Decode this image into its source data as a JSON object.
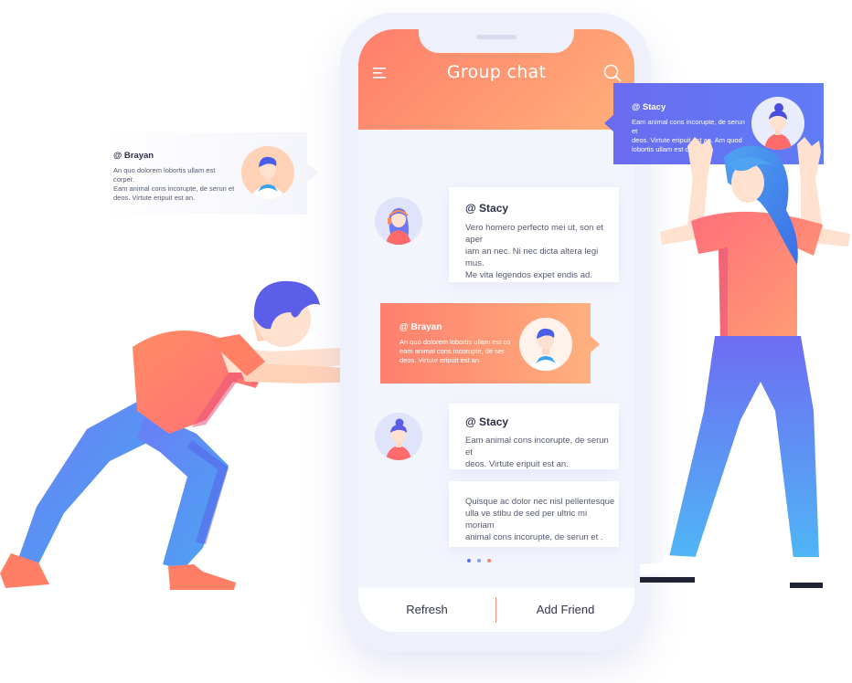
{
  "app": {
    "title": "Group chat"
  },
  "colors": {
    "header_start": "#ff7e6b",
    "header_end": "#ffb07a",
    "accent_blue": "#5f6df0",
    "divider": "#ff8a7a"
  },
  "icons": {
    "menu": "menu-icon",
    "search": "search-icon"
  },
  "messages": [
    {
      "name": "@ Stacy",
      "text_lines": [
        "Vero homero perfecto mei ut, son et aper",
        "iam an nec. Ni nec dicta altera legi mus.",
        "Me vita legendos expet endis ad."
      ]
    },
    {
      "name": "@ Brayan",
      "text_lines": [
        "An quo dolorem lobortis ullam est co",
        "eam animal cons incorupte, de ser",
        "deos. Virtute eripuit est an."
      ]
    },
    {
      "name": "@ Stacy",
      "text_lines": [
        "Eam animal cons incorupte, de serun et",
        "deos. Virtute eripuit est an."
      ]
    },
    {
      "name": "",
      "text_lines": [
        "Quisque ac dolor nec nisl pellentesque",
        "ulla ve stibu de sed per ultric mi moriam",
        "animal cons incorupte, de serun et ."
      ]
    }
  ],
  "pagination": {
    "dot_colors": [
      "#5f6df0",
      "#7ea0f5",
      "#ff7e6b"
    ]
  },
  "bottom": {
    "refresh_label": "Refresh",
    "add_friend_label": "Add Friend"
  },
  "floating": {
    "brayan": {
      "name": "@ Brayan",
      "text_lines": [
        "An quo dolorem lobortis ullam est corper.",
        "Eam animal cons incorupte, de serun et",
        "deos. Virtute eripuit est an."
      ]
    },
    "stacy": {
      "name": "@ Stacy",
      "text_lines": [
        "Eam animal cons incorupte, de serun et",
        "deos. Virtute eripuit est an. Am quod",
        "lobortis ullam est corper."
      ]
    }
  }
}
